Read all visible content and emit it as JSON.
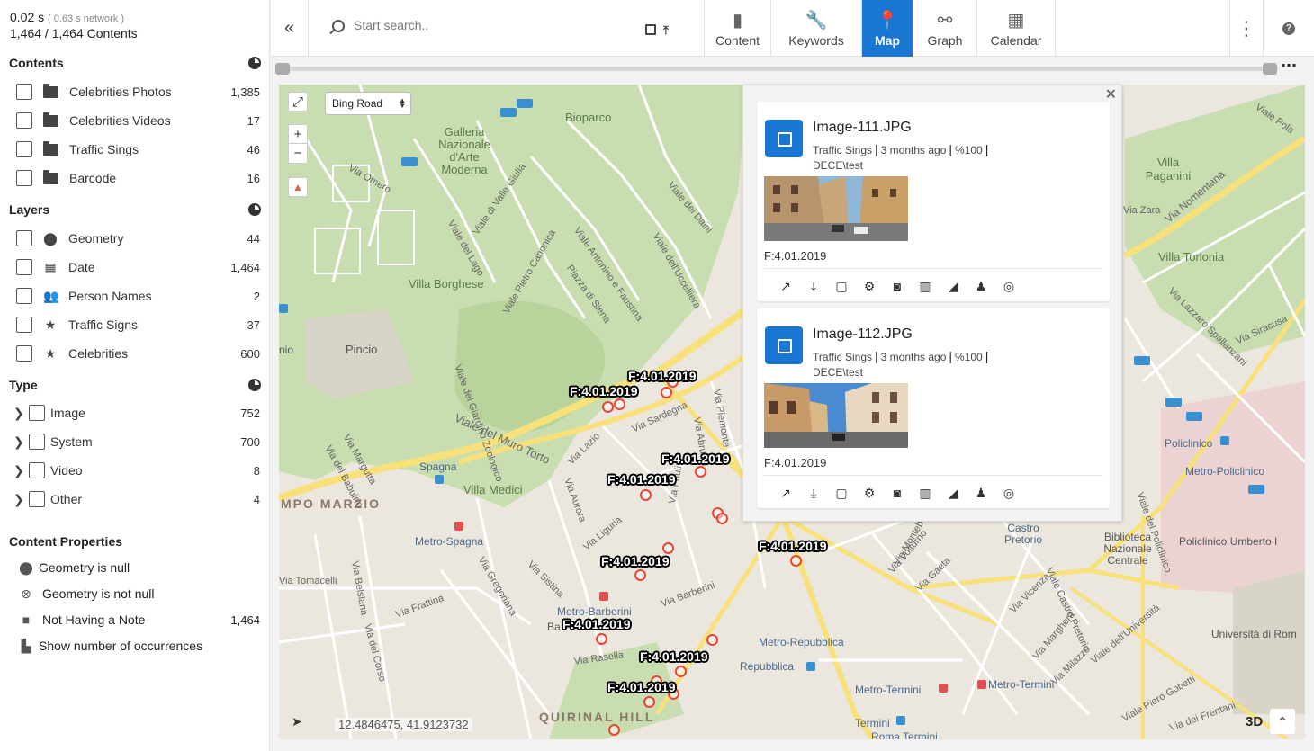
{
  "stats": {
    "time": "0.02 s",
    "network": "( 0.63 s network )",
    "contents": "1,464 / 1,464 Contents"
  },
  "sections": {
    "contents": "Contents",
    "layers": "Layers",
    "type": "Type",
    "properties": "Content Properties"
  },
  "contents_items": [
    {
      "label": "Celebrities Photos",
      "count": "1,385"
    },
    {
      "label": "Celebrities Videos",
      "count": "17"
    },
    {
      "label": "Traffic Sings",
      "count": "46"
    },
    {
      "label": "Barcode",
      "count": "16"
    }
  ],
  "layers_items": [
    {
      "label": "Geometry",
      "count": "44",
      "icon": "map-pin-icon"
    },
    {
      "label": "Date",
      "count": "1,464",
      "icon": "calendar-icon"
    },
    {
      "label": "Person Names",
      "count": "2",
      "icon": "people-icon"
    },
    {
      "label": "Traffic Signs",
      "count": "37",
      "icon": "star-icon"
    },
    {
      "label": "Celebrities",
      "count": "600",
      "icon": "star-icon"
    }
  ],
  "type_items": [
    {
      "label": "Image",
      "count": "752"
    },
    {
      "label": "System",
      "count": "700"
    },
    {
      "label": "Video",
      "count": "8"
    },
    {
      "label": "Other",
      "count": "4"
    }
  ],
  "property_items": [
    {
      "label": "Geometry is null",
      "count": ""
    },
    {
      "label": "Geometry is not null",
      "count": ""
    },
    {
      "label": "Not Having a Note",
      "count": "1,464"
    },
    {
      "label": "Show number of occurrences",
      "count": ""
    }
  ],
  "search": {
    "placeholder": "Start search.."
  },
  "tabs": [
    {
      "label": "Content",
      "icon": "book-icon"
    },
    {
      "label": "Keywords",
      "icon": "wrench-icon"
    },
    {
      "label": "Map",
      "icon": "map-pin-icon"
    },
    {
      "label": "Graph",
      "icon": "graph-icon"
    },
    {
      "label": "Calendar",
      "icon": "calendar-icon"
    }
  ],
  "map": {
    "layer_select": "Bing Road",
    "coordinates": "12.4846475, 41.9123732",
    "btn_3d": "3D",
    "marker_label": "F:4.01.2019",
    "places": {
      "galleria": "Galleria Nazionale d'Arte Moderna",
      "bioparco": "Bioparco",
      "villa_borghese": "Villa Borghese",
      "pincio": "Pincio",
      "villa_medici": "Villa Medici",
      "spagna": "Spagna",
      "campo_marzio": "MPO MARZIO",
      "metro_spagna": "Metro-Spagna",
      "metro_barberini": "Metro-Barberini",
      "quirinal_hill": "QUIRINAL HILL",
      "metro_repubblica": "Metro-Repubblica",
      "repubblica": "Repubblica",
      "metro_termini": "Metro-Termini",
      "metro_termini2": "Metro-Termini",
      "termini": "Termini",
      "roma_termini": "Roma Termini",
      "castro_pretorio": "Castro Pretorio",
      "biblioteca": "Biblioteca Nazionale Centrale",
      "policlinico": "Policlinico",
      "metro_policlinico": "Metro-Policlinico",
      "policlinico_umberto": "Policlinico Umberto I",
      "villa_paganini": "Villa Paganini",
      "villa_torlonia": "Villa Torlonia",
      "universita": "Università di Rom",
      "nio": "nio",
      "ba": "Ba"
    },
    "roads": [
      "Via Omero",
      "Viale di Valle Giulia",
      "Viale del Lago",
      "Viale Pietro Canonica",
      "Viale Antonino e Faustina",
      "Viale dei Daini",
      "Viale dell'Uccelliera",
      "Viale del Muro Torto",
      "Via Sardegna",
      "Via Lazio",
      "Via Aurora",
      "Via Liguria",
      "Via Barberini",
      "Via Sistina",
      "Via Margutta",
      "Via del Babuino",
      "Via Tomacelli",
      "Via Frattina",
      "Via Rasella",
      "Via Nomentana",
      "Viale Pola",
      "Via Zara",
      "Via Lazzaro Spallanzani",
      "Via Siracusa",
      "Via Volturno",
      "Via Gaeta",
      "Via Vicenza",
      "Viale Castro Pretorio",
      "Viale dell'Università",
      "Viale Piero Gobetti",
      "Via dei Frentani",
      "Via Piemonte",
      "Via Abruzzi",
      "Via Friuli",
      "Via Belsiana",
      "Via del Corso",
      "Via Marghera",
      "Via Milazzo",
      "Via Montebello",
      "Via Gregoriana",
      "Viale del Policlinico",
      "Piazza di Siena",
      "Viale del Giardino Zoologico"
    ]
  },
  "popup": {
    "cards": [
      {
        "title": "Image-111.JPG",
        "category": "Traffic Sings",
        "age": "3 months ago",
        "percent": "%100",
        "path": "DECE\\test",
        "date": "F:4.01.2019"
      },
      {
        "title": "Image-112.JPG",
        "category": "Traffic Sings",
        "age": "3 months ago",
        "percent": "%100",
        "path": "DECE\\test",
        "date": "F:4.01.2019"
      }
    ],
    "action_icons": [
      "open-external-icon",
      "download-icon",
      "note-icon",
      "settings-icon",
      "tag-image-icon",
      "map-icon",
      "chart-icon",
      "person-icon",
      "view-icon"
    ]
  },
  "colors": {
    "accent": "#1976d2",
    "marker": "#e43",
    "park": "#c8ddb0",
    "road": "#f8e07a"
  }
}
